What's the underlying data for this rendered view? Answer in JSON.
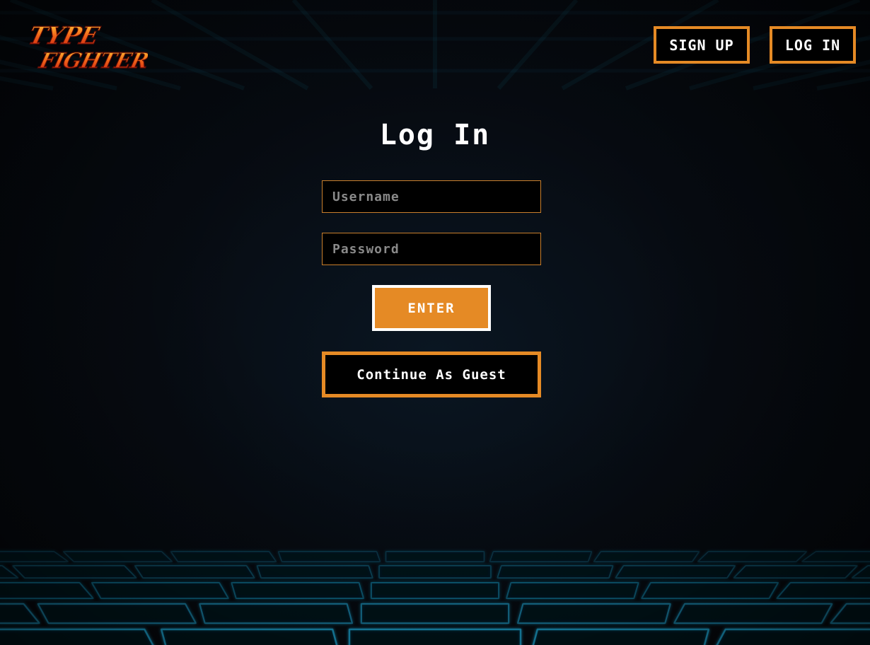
{
  "colors": {
    "accent": "#e58a25",
    "background": "#05070b",
    "grid_glow": "#1fb6e8"
  },
  "header": {
    "logo_line1": "TYPE",
    "logo_line2": "FIGHTER",
    "signup_label": "SIGN UP",
    "login_label": "LOG IN"
  },
  "form": {
    "title": "Log In",
    "username_placeholder": "Username",
    "password_placeholder": "Password",
    "enter_label": "ENTER",
    "guest_label": "Continue As Guest"
  }
}
